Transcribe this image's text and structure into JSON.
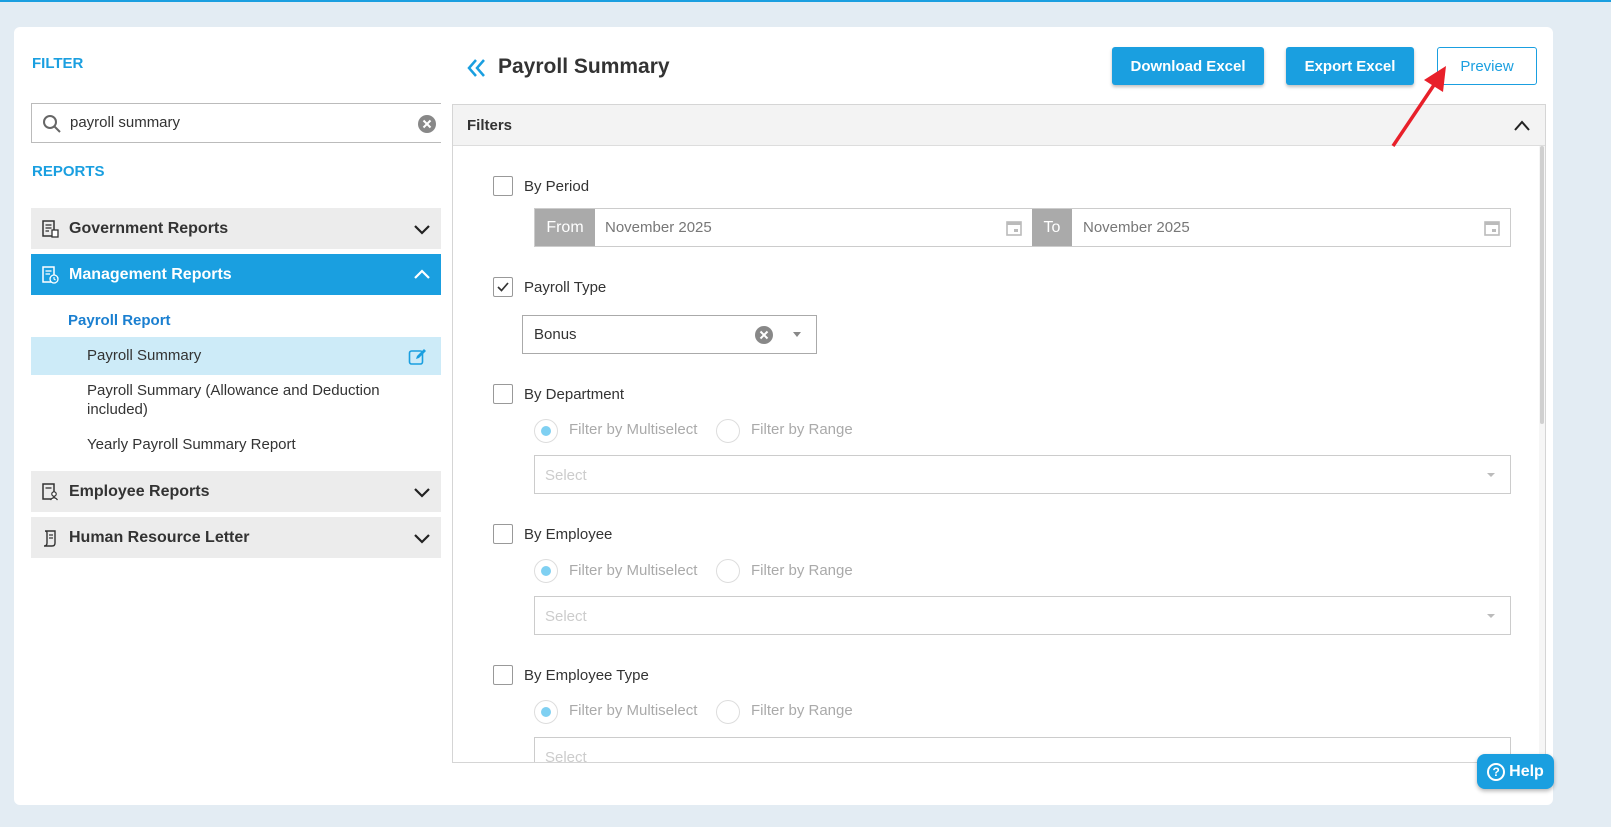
{
  "left": {
    "filter_label": "FILTER",
    "search": {
      "value": "payroll summary"
    },
    "reports_label": "REPORTS",
    "groups": [
      {
        "label": "Government Reports",
        "icon": "report-icon",
        "expanded": false
      },
      {
        "label": "Management Reports",
        "icon": "report-clock-icon",
        "expanded": true
      },
      {
        "label": "Employee Reports",
        "icon": "employee-report-icon",
        "expanded": false
      },
      {
        "label": "Human Resource Letter",
        "icon": "letter-icon",
        "expanded": false
      }
    ],
    "subheading": "Payroll Report",
    "items": [
      {
        "label": "Payroll Summary",
        "selected": true
      },
      {
        "label": "Payroll Summary (Allowance and Deduction included)",
        "selected": false
      },
      {
        "label": "Yearly Payroll Summary Report",
        "selected": false
      }
    ]
  },
  "main": {
    "title": "Payroll Summary",
    "buttons": {
      "download": "Download Excel",
      "export": "Export Excel",
      "preview": "Preview"
    },
    "filters_title": "Filters",
    "by_period": {
      "label": "By Period",
      "checked": false,
      "from_label": "From",
      "from_value": "November 2025",
      "to_label": "To",
      "to_value": "November 2025"
    },
    "payroll_type": {
      "label": "Payroll Type",
      "checked": true,
      "value": "Bonus"
    },
    "by_department": {
      "label": "By Department",
      "checked": false
    },
    "by_employee": {
      "label": "By Employee",
      "checked": false
    },
    "by_employee_type": {
      "label": "By Employee Type",
      "checked": false
    },
    "radio_multiselect": "Filter by Multiselect",
    "radio_range": "Filter by Range",
    "select_placeholder": "Select"
  },
  "help": {
    "label": "Help"
  },
  "colors": {
    "accent": "#1a9fe0",
    "arrow": "#e8202a"
  }
}
